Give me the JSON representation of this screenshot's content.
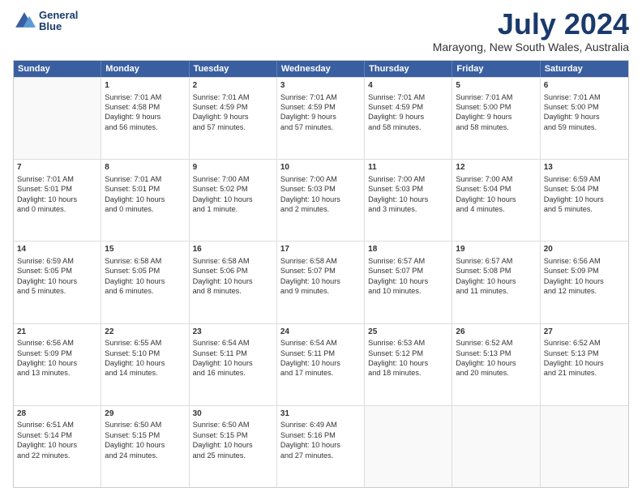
{
  "header": {
    "logo_line1": "General",
    "logo_line2": "Blue",
    "month_year": "July 2024",
    "location": "Marayong, New South Wales, Australia"
  },
  "days": [
    "Sunday",
    "Monday",
    "Tuesday",
    "Wednesday",
    "Thursday",
    "Friday",
    "Saturday"
  ],
  "weeks": [
    [
      {
        "day": "",
        "text": ""
      },
      {
        "day": "1",
        "text": "Sunrise: 7:01 AM\nSunset: 4:58 PM\nDaylight: 9 hours\nand 56 minutes."
      },
      {
        "day": "2",
        "text": "Sunrise: 7:01 AM\nSunset: 4:59 PM\nDaylight: 9 hours\nand 57 minutes."
      },
      {
        "day": "3",
        "text": "Sunrise: 7:01 AM\nSunset: 4:59 PM\nDaylight: 9 hours\nand 57 minutes."
      },
      {
        "day": "4",
        "text": "Sunrise: 7:01 AM\nSunset: 4:59 PM\nDaylight: 9 hours\nand 58 minutes."
      },
      {
        "day": "5",
        "text": "Sunrise: 7:01 AM\nSunset: 5:00 PM\nDaylight: 9 hours\nand 58 minutes."
      },
      {
        "day": "6",
        "text": "Sunrise: 7:01 AM\nSunset: 5:00 PM\nDaylight: 9 hours\nand 59 minutes."
      }
    ],
    [
      {
        "day": "7",
        "text": "Sunrise: 7:01 AM\nSunset: 5:01 PM\nDaylight: 10 hours\nand 0 minutes."
      },
      {
        "day": "8",
        "text": "Sunrise: 7:01 AM\nSunset: 5:01 PM\nDaylight: 10 hours\nand 0 minutes."
      },
      {
        "day": "9",
        "text": "Sunrise: 7:00 AM\nSunset: 5:02 PM\nDaylight: 10 hours\nand 1 minute."
      },
      {
        "day": "10",
        "text": "Sunrise: 7:00 AM\nSunset: 5:03 PM\nDaylight: 10 hours\nand 2 minutes."
      },
      {
        "day": "11",
        "text": "Sunrise: 7:00 AM\nSunset: 5:03 PM\nDaylight: 10 hours\nand 3 minutes."
      },
      {
        "day": "12",
        "text": "Sunrise: 7:00 AM\nSunset: 5:04 PM\nDaylight: 10 hours\nand 4 minutes."
      },
      {
        "day": "13",
        "text": "Sunrise: 6:59 AM\nSunset: 5:04 PM\nDaylight: 10 hours\nand 5 minutes."
      }
    ],
    [
      {
        "day": "14",
        "text": "Sunrise: 6:59 AM\nSunset: 5:05 PM\nDaylight: 10 hours\nand 5 minutes."
      },
      {
        "day": "15",
        "text": "Sunrise: 6:58 AM\nSunset: 5:05 PM\nDaylight: 10 hours\nand 6 minutes."
      },
      {
        "day": "16",
        "text": "Sunrise: 6:58 AM\nSunset: 5:06 PM\nDaylight: 10 hours\nand 8 minutes."
      },
      {
        "day": "17",
        "text": "Sunrise: 6:58 AM\nSunset: 5:07 PM\nDaylight: 10 hours\nand 9 minutes."
      },
      {
        "day": "18",
        "text": "Sunrise: 6:57 AM\nSunset: 5:07 PM\nDaylight: 10 hours\nand 10 minutes."
      },
      {
        "day": "19",
        "text": "Sunrise: 6:57 AM\nSunset: 5:08 PM\nDaylight: 10 hours\nand 11 minutes."
      },
      {
        "day": "20",
        "text": "Sunrise: 6:56 AM\nSunset: 5:09 PM\nDaylight: 10 hours\nand 12 minutes."
      }
    ],
    [
      {
        "day": "21",
        "text": "Sunrise: 6:56 AM\nSunset: 5:09 PM\nDaylight: 10 hours\nand 13 minutes."
      },
      {
        "day": "22",
        "text": "Sunrise: 6:55 AM\nSunset: 5:10 PM\nDaylight: 10 hours\nand 14 minutes."
      },
      {
        "day": "23",
        "text": "Sunrise: 6:54 AM\nSunset: 5:11 PM\nDaylight: 10 hours\nand 16 minutes."
      },
      {
        "day": "24",
        "text": "Sunrise: 6:54 AM\nSunset: 5:11 PM\nDaylight: 10 hours\nand 17 minutes."
      },
      {
        "day": "25",
        "text": "Sunrise: 6:53 AM\nSunset: 5:12 PM\nDaylight: 10 hours\nand 18 minutes."
      },
      {
        "day": "26",
        "text": "Sunrise: 6:52 AM\nSunset: 5:13 PM\nDaylight: 10 hours\nand 20 minutes."
      },
      {
        "day": "27",
        "text": "Sunrise: 6:52 AM\nSunset: 5:13 PM\nDaylight: 10 hours\nand 21 minutes."
      }
    ],
    [
      {
        "day": "28",
        "text": "Sunrise: 6:51 AM\nSunset: 5:14 PM\nDaylight: 10 hours\nand 22 minutes."
      },
      {
        "day": "29",
        "text": "Sunrise: 6:50 AM\nSunset: 5:15 PM\nDaylight: 10 hours\nand 24 minutes."
      },
      {
        "day": "30",
        "text": "Sunrise: 6:50 AM\nSunset: 5:15 PM\nDaylight: 10 hours\nand 25 minutes."
      },
      {
        "day": "31",
        "text": "Sunrise: 6:49 AM\nSunset: 5:16 PM\nDaylight: 10 hours\nand 27 minutes."
      },
      {
        "day": "",
        "text": ""
      },
      {
        "day": "",
        "text": ""
      },
      {
        "day": "",
        "text": ""
      }
    ]
  ]
}
